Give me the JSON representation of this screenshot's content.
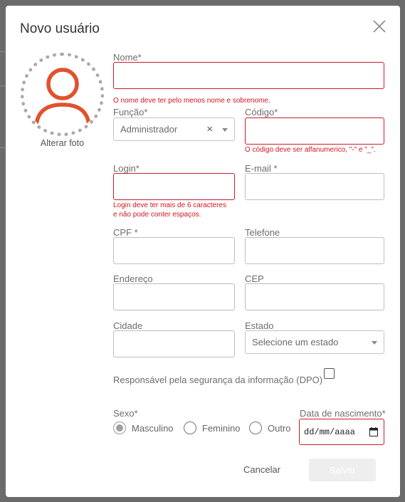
{
  "modal": {
    "title": "Novo usuário"
  },
  "avatar": {
    "change_label": "Alterar foto",
    "icon": "user-icon",
    "accent": "#e0522d"
  },
  "fields": {
    "nome": {
      "label": "Nome*",
      "value": "",
      "error": "O nome deve ter pelo menos nome e sobrenome."
    },
    "funcao": {
      "label": "Função*",
      "value": "Administrador"
    },
    "codigo": {
      "label": "Código*",
      "value": "",
      "error": "O código deve ser alfanumerico, \"-\" e \"_\"."
    },
    "login": {
      "label": "Login*",
      "value": "",
      "error_line1": "Login deve ter mais de 6 caracteres",
      "error_line2": "e não pode conter espaços."
    },
    "email": {
      "label": "E-mail *",
      "value": ""
    },
    "cpf": {
      "label": "CPF *",
      "value": ""
    },
    "telefone": {
      "label": "Telefone",
      "value": ""
    },
    "endereco": {
      "label": "Endereço",
      "value": ""
    },
    "cep": {
      "label": "CEP",
      "value": ""
    },
    "cidade": {
      "label": "Cidade",
      "value": ""
    },
    "estado": {
      "label": "Estado",
      "placeholder": "Selecione um estado"
    },
    "dpo": {
      "label": "Responsável pela segurança da informação (DPO)",
      "checked": false
    },
    "sexo": {
      "label": "Sexo*",
      "options": [
        "Masculino",
        "Feminino",
        "Outro"
      ],
      "selected": "Masculino"
    },
    "nascimento": {
      "label": "Data de nascimento*",
      "placeholder": "dd/mm/aaaa"
    }
  },
  "actions": {
    "cancel_label": "Cancelar",
    "save_label": "Salvar"
  },
  "colors": {
    "error": "#d0161f",
    "error_border": "#cc1a2a"
  }
}
